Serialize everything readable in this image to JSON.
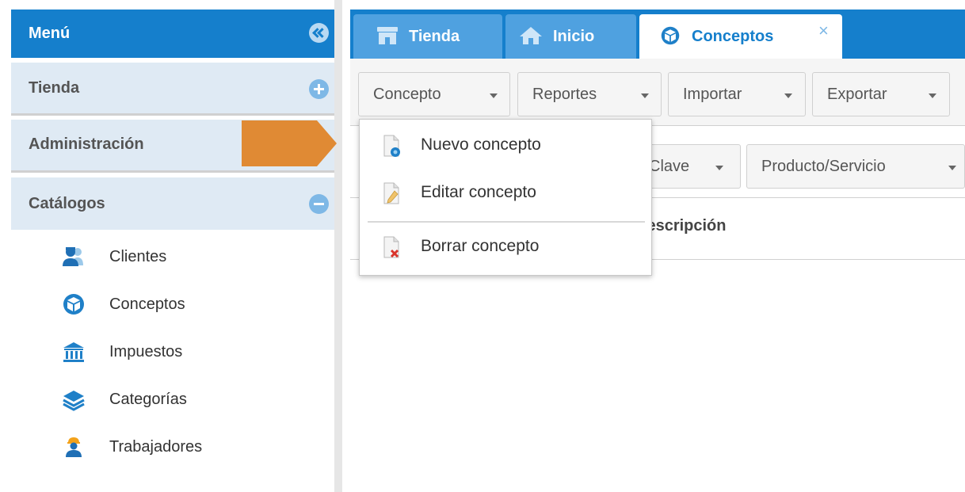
{
  "sidebar": {
    "title": "Menú",
    "sections": {
      "tienda": "Tienda",
      "administracion": "Administración",
      "catalogos": "Catálogos"
    },
    "items": [
      {
        "label": "Clientes",
        "icon": "users-icon"
      },
      {
        "label": "Conceptos",
        "icon": "cube-icon"
      },
      {
        "label": "Impuestos",
        "icon": "bank-icon"
      },
      {
        "label": "Categorías",
        "icon": "layers-icon"
      },
      {
        "label": "Trabajadores",
        "icon": "worker-icon"
      }
    ]
  },
  "tabs": [
    {
      "label": "Tienda",
      "icon": "store-icon",
      "active": false
    },
    {
      "label": "Inicio",
      "icon": "home-icon",
      "active": false
    },
    {
      "label": "Conceptos",
      "icon": "cube-icon",
      "active": true,
      "closable": true
    }
  ],
  "toolbar": {
    "concepto": "Concepto",
    "reportes": "Reportes",
    "importar": "Importar",
    "exportar": "Exportar"
  },
  "filters": {
    "clave": "Clave",
    "producto": "Producto/Servicio"
  },
  "grid": {
    "column_descripcion": "Descripción"
  },
  "dropdown_menu": {
    "items": [
      {
        "label": "Nuevo concepto",
        "icon": "new-document-icon"
      },
      {
        "label": "Editar concepto",
        "icon": "edit-document-icon"
      },
      {
        "label": "Borrar concepto",
        "icon": "delete-document-icon"
      }
    ]
  },
  "colors": {
    "primary_blue": "#157fcc",
    "tab_inactive": "#4fa1e0",
    "section_bg": "#dfeaf4",
    "arrow_orange": "#e08a34"
  }
}
